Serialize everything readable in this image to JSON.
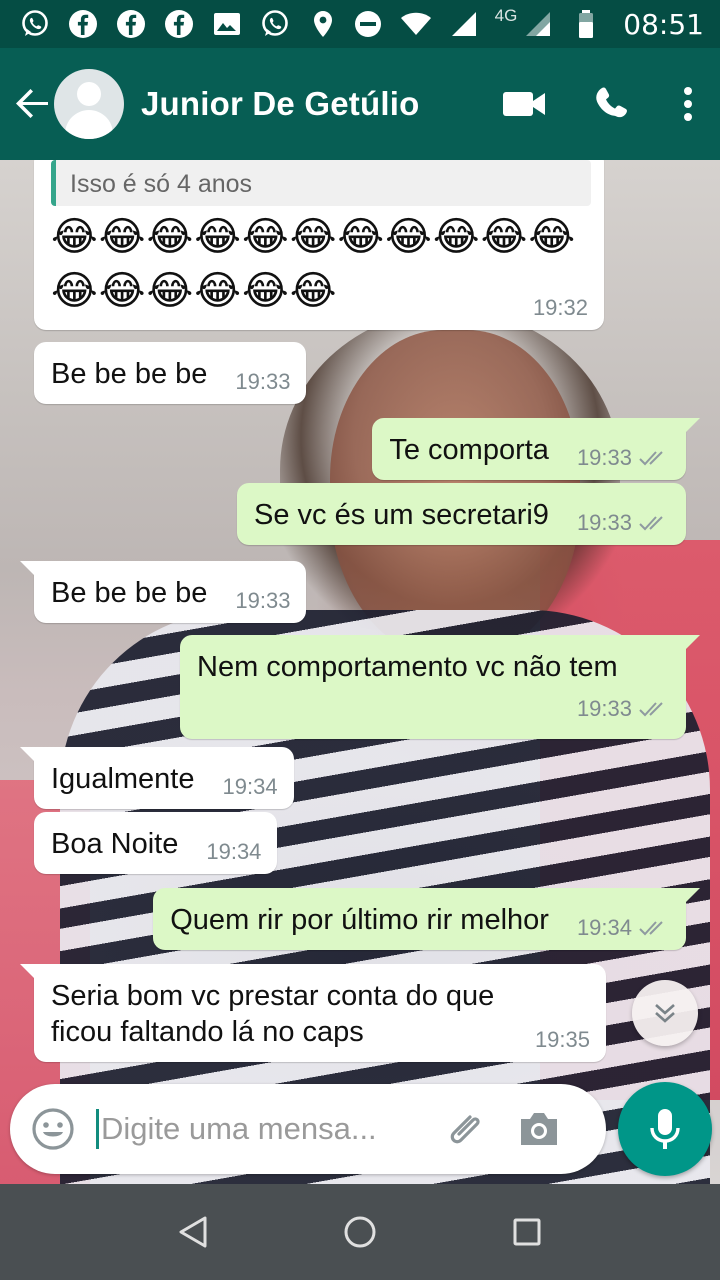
{
  "status_bar": {
    "network_label": "4G",
    "time": "08:51",
    "icons": [
      "whatsapp-icon",
      "facebook-icon",
      "facebook-icon",
      "facebook-icon",
      "image-icon",
      "whatsapp-icon",
      "location-icon",
      "do-not-disturb-icon",
      "wifi-icon",
      "signal-icon",
      "battery-icon"
    ]
  },
  "header": {
    "contact_name": "Junior De Getúlio",
    "icons": [
      "back-arrow-icon",
      "avatar",
      "video-call-icon",
      "phone-icon",
      "more-vert-icon"
    ]
  },
  "chat": {
    "first_message": {
      "quote": "Isso é só 4 anos",
      "emoji_line_1": "😂😂😂😂😂😂😂😂😂😂😂",
      "emoji_line_2": "😂😂😂😂😂😂",
      "time": "19:32"
    },
    "messages": [
      {
        "direction": "in",
        "text": "Be be be be",
        "time": "19:33"
      },
      {
        "direction": "out",
        "text": "Te comporta",
        "time": "19:33",
        "status": "read"
      },
      {
        "direction": "out",
        "text": "Se vc és um secretari9",
        "time": "19:33",
        "status": "read"
      },
      {
        "direction": "in",
        "text": "Be be be be",
        "time": "19:33"
      },
      {
        "direction": "out",
        "text": "Nem comportamento vc não tem",
        "time": "19:33",
        "status": "read"
      },
      {
        "direction": "in",
        "text": "Igualmente",
        "time": "19:34"
      },
      {
        "direction": "in",
        "text": "Boa Noite",
        "time": "19:34"
      },
      {
        "direction": "out",
        "text": "Quem rir por último rir melhor",
        "time": "19:34",
        "status": "read"
      },
      {
        "direction": "in",
        "text_line_1": "Seria bom vc prestar conta do que",
        "text_line_2": "ficou faltando lá no caps",
        "time": "19:35"
      }
    ]
  },
  "composer": {
    "placeholder": "Digite uma mensa...",
    "icons": [
      "emoji-icon",
      "attach-icon",
      "camera-icon",
      "mic-icon"
    ]
  },
  "colors": {
    "status_bar": "#054d44",
    "header": "#075e54",
    "outgoing_bubble": "#dcf8c6",
    "incoming_bubble": "#ffffff",
    "accent": "#009688",
    "read_ticks": "#7f8a8f"
  }
}
